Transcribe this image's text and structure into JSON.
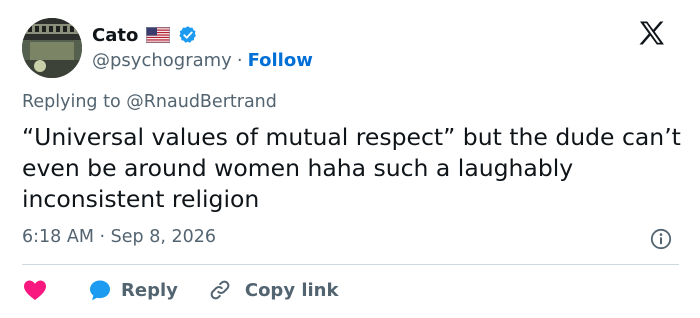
{
  "author": {
    "name": "Cato",
    "handle": "@psychogramy",
    "separator": "·",
    "follow_label": "Follow"
  },
  "reply_context": {
    "prefix": "Replying to",
    "mention": "@RnaudBertrand"
  },
  "tweet": {
    "text": "“Universal values of mutual respect” but the dude can’t even be around women haha such a laughably inconsistent religion",
    "time": "6:18 AM",
    "separator": "·",
    "date": "Sep 8, 2026"
  },
  "actions": {
    "reply_label": "Reply",
    "copy_link_label": "Copy link"
  },
  "icons": {
    "flag": "us-flag-icon",
    "verified": "verified-badge-icon",
    "logo": "x-logo-icon",
    "info": "info-icon",
    "like": "heart-icon",
    "reply": "reply-bubble-icon",
    "link": "link-icon"
  },
  "colors": {
    "text": "#0f1419",
    "secondary": "#536471",
    "link": "#006fd6",
    "verified": "#1d9bf0",
    "like": "#f91880",
    "divider": "#cfd9de"
  }
}
